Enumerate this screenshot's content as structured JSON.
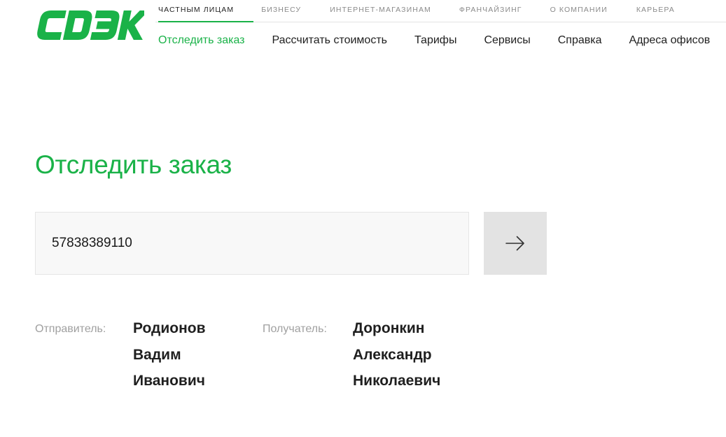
{
  "brand": {
    "logo_text": "CDEK",
    "color": "#1ab248"
  },
  "segments": [
    {
      "label": "ЧАСТНЫМ ЛИЦАМ",
      "active": true
    },
    {
      "label": "БИЗНЕСУ",
      "active": false
    },
    {
      "label": "ИНТЕРНЕТ-МАГАЗИНАМ",
      "active": false
    },
    {
      "label": "ФРАНЧАЙЗИНГ",
      "active": false
    },
    {
      "label": "О КОМПАНИИ",
      "active": false
    },
    {
      "label": "КАРЬЕРА",
      "active": false
    }
  ],
  "nav": [
    {
      "label": "Отследить заказ",
      "active": true
    },
    {
      "label": "Рассчитать стоимость",
      "active": false
    },
    {
      "label": "Тарифы",
      "active": false
    },
    {
      "label": "Сервисы",
      "active": false
    },
    {
      "label": "Справка",
      "active": false
    },
    {
      "label": "Адреса офисов",
      "active": false
    }
  ],
  "tracking": {
    "title": "Отследить заказ",
    "order_number": "57838389110",
    "submit_icon": "arrow-right-icon"
  },
  "sender": {
    "label": "Отправитель:",
    "name_lines": [
      "Родионов",
      "Вадим",
      "Иванович"
    ]
  },
  "recipient": {
    "label": "Получатель:",
    "name_lines": [
      "Доронкин",
      "Александр",
      "Николаевич"
    ]
  }
}
